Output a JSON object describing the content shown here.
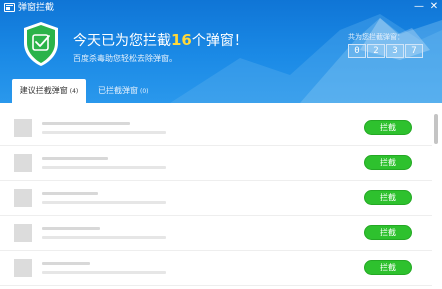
{
  "window": {
    "title": "弹窗拦截",
    "minimize": "—",
    "close": "✕"
  },
  "header": {
    "headline_prefix": "今天已为您拦截",
    "headline_count": "16",
    "headline_suffix": "个弹窗！",
    "subline": "百度杀毒助您轻松去除弹窗。",
    "counter_label": "共为您拦截弹窗：",
    "counter_digits": [
      "0",
      "2",
      "3",
      "7"
    ]
  },
  "tabs": [
    {
      "label": "建议拦截弹窗",
      "count": "(4)",
      "active": true
    },
    {
      "label": "已拦截弹窗",
      "count": "(0)",
      "active": false
    }
  ],
  "rows": [
    {
      "action": "拦截"
    },
    {
      "action": "拦截"
    },
    {
      "action": "拦截"
    },
    {
      "action": "拦截"
    },
    {
      "action": "拦截"
    }
  ],
  "colors": {
    "header_blue": "#1b8ae6",
    "counter_highlight": "#ffd83a",
    "button_green": "#2ec12e",
    "shield_green": "#2bb34a"
  },
  "icons": {
    "app": "window-icon",
    "shield": "shield-check-icon"
  }
}
